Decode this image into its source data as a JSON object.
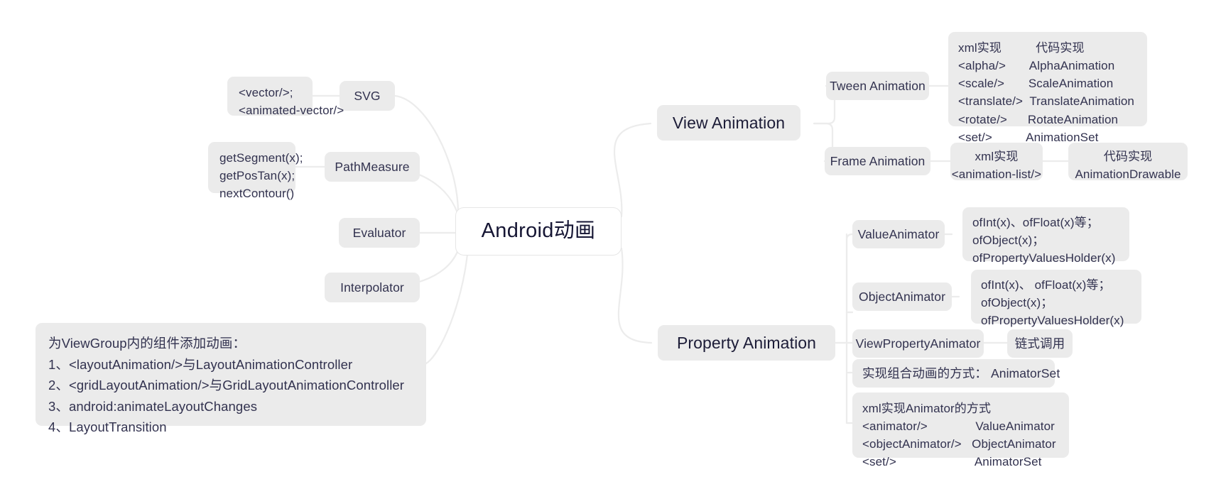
{
  "diagram": {
    "title": "Android动画",
    "type": "mind-map",
    "colors": {
      "node_background": "#ebebeb",
      "center_background": "#ffffff",
      "center_border": "#e6e6e6",
      "text": "#32324f",
      "center_text": "#161634",
      "edge": "#ececec",
      "page_background": "#ffffff"
    }
  },
  "center": {
    "label": "Android动画"
  },
  "left_branches": [
    {
      "id": "svg",
      "label": "SVG",
      "detail": "<vector/>;\n<animated-vector/>"
    },
    {
      "id": "pathmeasure",
      "label": "PathMeasure",
      "detail": "getSegment(x);\ngetPosTan(x);\nnextContour()"
    },
    {
      "id": "evaluator",
      "label": "Evaluator",
      "detail": ""
    },
    {
      "id": "interpolator",
      "label": "Interpolator",
      "detail": ""
    },
    {
      "id": "layout-animation",
      "label": "为ViewGroup内的组件添加动画：\n1、<layoutAnimation/>与LayoutAnimationController\n2、<gridLayoutAnimation/>与GridLayoutAnimationController\n3、android:animateLayoutChanges\n4、LayoutTransition",
      "detail": ""
    }
  ],
  "right_branches": [
    {
      "id": "view-animation",
      "label": "View Animation",
      "children": [
        {
          "id": "tween-animation",
          "label": "Tween Animation",
          "detail": "xml实现          代码实现\n<alpha/>       AlphaAnimation\n<scale/>       ScaleAnimation\n<translate/>  TranslateAnimation\n<rotate/>      RotateAnimation\n<set/>          AnimationSet"
        },
        {
          "id": "frame-animation",
          "label": "Frame Animation",
          "detail": "xml实现\n<animation-list/>",
          "detail2": "代码实现\nAnimationDrawable"
        }
      ]
    },
    {
      "id": "property-animation",
      "label": "Property Animation",
      "children": [
        {
          "id": "value-animator",
          "label": "ValueAnimator",
          "detail": "ofInt(x)、ofFloat(x)等；\nofObject(x)；\nofPropertyValuesHolder(x)"
        },
        {
          "id": "object-animator",
          "label": "ObjectAnimator",
          "detail": "ofInt(x)、 ofFloat(x)等；\nofObject(x)；\nofPropertyValuesHolder(x)"
        },
        {
          "id": "view-property-animator",
          "label": "ViewPropertyAnimator",
          "detail": "链式调用"
        },
        {
          "id": "animator-set",
          "label": "实现组合动画的方式： AnimatorSet",
          "detail": ""
        },
        {
          "id": "xml-animator",
          "label": "xml实现Animator的方式\n<animator/>              ValueAnimator\n<objectAnimator/>   ObjectAnimator\n<set/>                       AnimatorSet",
          "detail": ""
        }
      ]
    }
  ]
}
